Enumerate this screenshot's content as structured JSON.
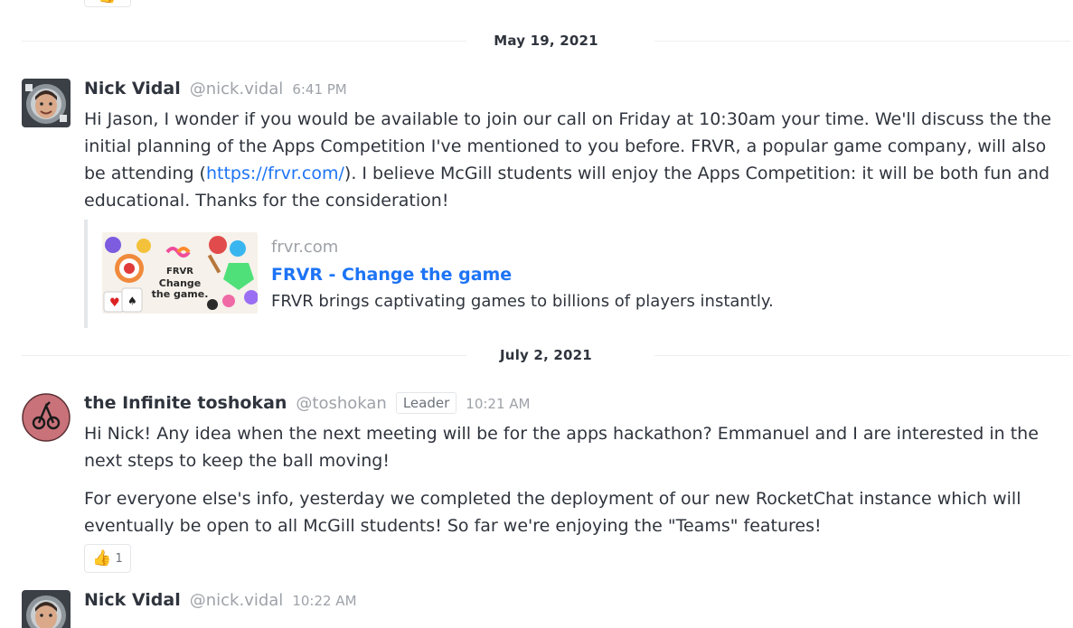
{
  "top_reaction": {
    "emoji": "👍"
  },
  "dividers": [
    "May 19, 2021",
    "July 2, 2021"
  ],
  "messages": [
    {
      "name": "Nick Vidal",
      "username": "@nick.vidal",
      "time": "6:41 PM",
      "text_before_link": "Hi Jason, I wonder if you would be available to join our call on Friday at 10:30am your time. We'll discuss the the initial planning of the Apps Competition I've mentioned to you before. FRVR, a popular game company, will also be attending (",
      "link": "https://frvr.com/",
      "text_after_link": "). I believe McGill students will enjoy the Apps Competition: it will be both fun and educational. Thanks for the consideration!",
      "preview": {
        "host": "frvr.com",
        "title": "FRVR - Change the game",
        "description": "FRVR brings captivating games to billions of players instantly.",
        "thumb_brand": "FRVR",
        "thumb_tag1": "Change",
        "thumb_tag2": "the game."
      }
    },
    {
      "name": "the Infinite toshokan",
      "username": "@toshokan",
      "role": "Leader",
      "time": "10:21 AM",
      "paragraph1": "Hi Nick! Any idea when the next meeting will be for the apps hackathon? Emmanuel and I are interested in the next steps to keep the ball moving!",
      "paragraph2": "For everyone else's info, yesterday we completed the deployment of our new RocketChat instance which will eventually be open to all McGill students! So far we're enjoying the \"Teams\" features!",
      "reaction": {
        "emoji": "👍",
        "count": "1"
      }
    },
    {
      "name": "Nick Vidal",
      "username": "@nick.vidal",
      "time": "10:22 AM"
    }
  ],
  "colors": {
    "link": "#1d74f5",
    "text": "#2f343d",
    "muted": "#9ea2a8",
    "border": "#e4e7ea"
  }
}
